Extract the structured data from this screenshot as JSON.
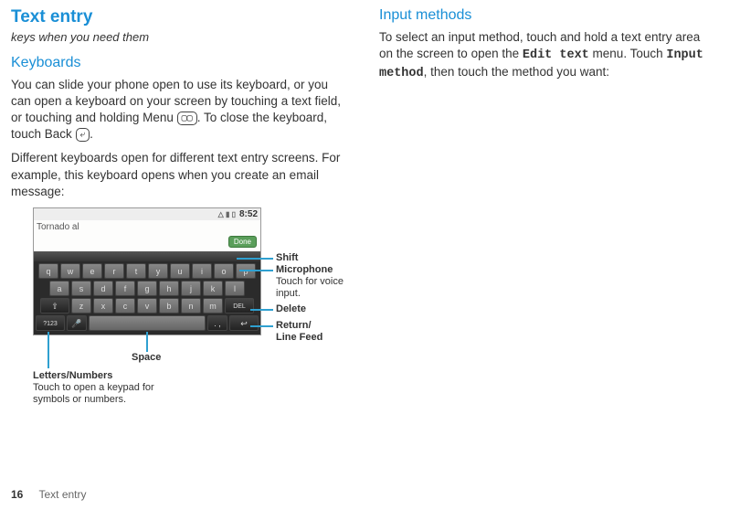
{
  "left": {
    "title": "Text entry",
    "subtitle": "keys when you need them",
    "keyboards_heading": "Keyboards",
    "para1a": "You can slide your phone open to use its keyboard, or you can open a keyboard on your screen by touching a text field, or touching and holding Menu ",
    "para1b": ". To close the keyboard, touch Back ",
    "para1c": ".",
    "menu_icon": "▢▢",
    "back_icon": "⤶",
    "para2": "Different keyboards open for different text entry screens. For example, this keyboard opens when you create an email message:"
  },
  "kb": {
    "time": "8:52",
    "typed": "Tornado al",
    "done": "Done",
    "row1": [
      "q",
      "w",
      "e",
      "r",
      "t",
      "y",
      "u",
      "i",
      "o",
      "p"
    ],
    "row2": [
      "a",
      "s",
      "d",
      "f",
      "g",
      "h",
      "j",
      "k",
      "l"
    ],
    "shift": "⇧",
    "row3": [
      "z",
      "x",
      "c",
      "v",
      "b",
      "n",
      "m"
    ],
    "del": "DEL",
    "sym": "?123",
    "mic": "🎤",
    "period": ". ,",
    "ret": "↩",
    "labels": {
      "shift": "Shift",
      "mic_head": "Microphone",
      "mic_body": "Touch for voice input.",
      "delete": "Delete",
      "return": "Return/\nLine Feed",
      "space": "Space",
      "ln_head": "Letters/Numbers",
      "ln_body": "Touch to open a keypad for symbols or numbers."
    }
  },
  "right": {
    "heading": "Input methods",
    "para_a": "To select an input method, touch and hold a text entry area on the screen to open the ",
    "edit_text": "Edit text",
    "para_b": " menu. Touch ",
    "input_method": "Input method",
    "para_c": ", then touch the method you want:"
  },
  "footer": {
    "page": "16",
    "section": "Text entry"
  }
}
